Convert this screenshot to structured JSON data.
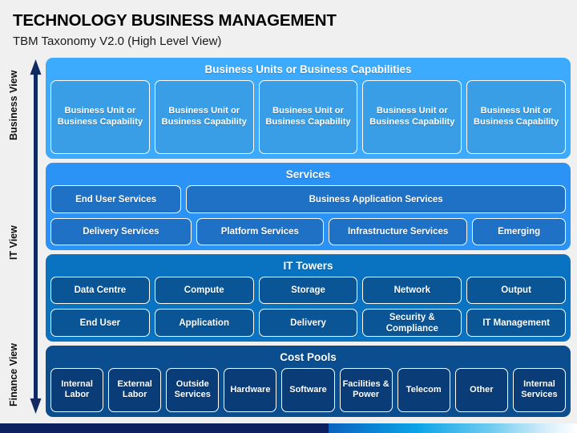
{
  "header": {
    "title": "TECHNOLOGY BUSINESS MANAGEMENT",
    "subtitle": "TBM Taxonomy V2.0 (High Level View)"
  },
  "axis": {
    "arrow_icon": "double-headed-vertical-arrow-icon",
    "labels": [
      {
        "text": "Business View"
      },
      {
        "text": "IT View"
      },
      {
        "text": "Finance View"
      }
    ]
  },
  "sections": [
    {
      "id": "business-units",
      "title": "Business Units or Business Capabilities",
      "panel_color": "#3dabfd",
      "cell_color": "#3a9ee6",
      "rows": [
        {
          "cells": [
            "Business Unit or Business Capability",
            "Business Unit or Business Capability",
            "Business Unit or Business Capability",
            "Business Unit or Business Capability",
            "Business Unit or Business Capability"
          ]
        }
      ]
    },
    {
      "id": "services",
      "title": "Services",
      "panel_color": "#2b92f6",
      "cell_color": "#1f71c6",
      "rows": [
        {
          "cells": [
            "End User Services",
            "Business Application Services"
          ],
          "flex": [
            1,
            3
          ]
        },
        {
          "cells": [
            "Delivery Services",
            "Platform Services",
            "Infrastructure Services",
            "Emerging"
          ],
          "flex": [
            1.42,
            1.28,
            1.4,
            0.92
          ]
        }
      ]
    },
    {
      "id": "it-towers",
      "title": "IT Towers",
      "panel_color": "#0a73c1",
      "cell_color": "#0a5596",
      "rows": [
        {
          "cells": [
            "Data Centre",
            "Compute",
            "Storage",
            "Network",
            "Output"
          ]
        },
        {
          "cells": [
            "End User",
            "Application",
            "Delivery",
            "Security & Compliance",
            "IT Management"
          ]
        }
      ]
    },
    {
      "id": "cost-pools",
      "title": "Cost Pools",
      "panel_color": "#0b4e8f",
      "cell_color": "#0a3c78",
      "rows": [
        {
          "cells": [
            "Internal Labor",
            "External Labor",
            "Outside Services",
            "Hardware",
            "Software",
            "Facilities & Power",
            "Telecom",
            "Other",
            "Internal Services"
          ]
        }
      ]
    }
  ],
  "bottom_strip": {
    "solid_color": "#0c1f5e",
    "gradient_from": "#0b63c0",
    "gradient_to": "#ffffff"
  }
}
